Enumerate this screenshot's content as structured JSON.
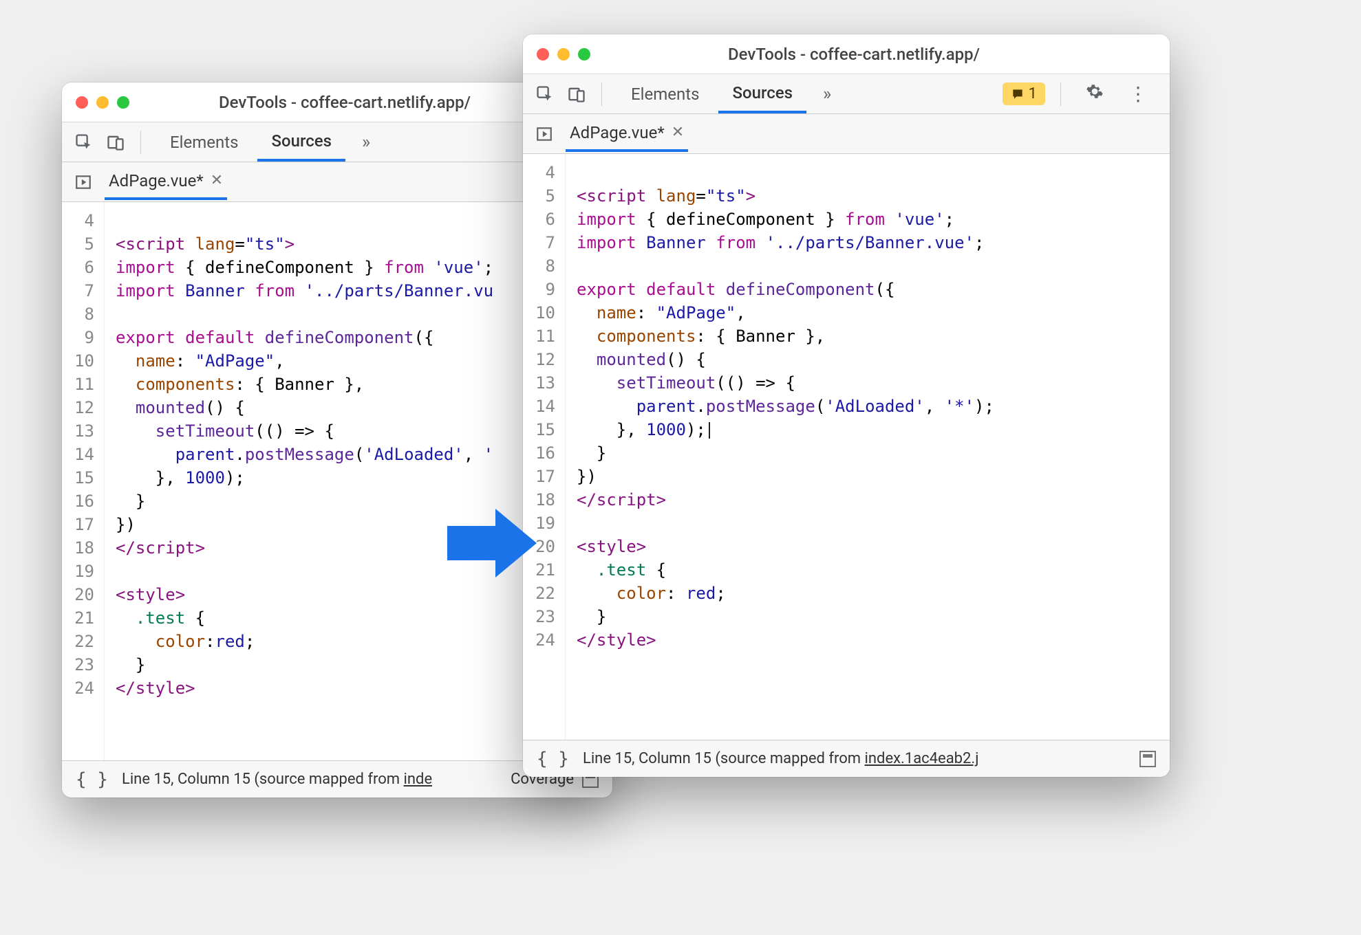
{
  "winA": {
    "title": "DevTools - coffee-cart.netlify.app/",
    "tabs": {
      "elements": "Elements",
      "sources": "Sources",
      "more": "»"
    },
    "file_tab": "AdPage.vue*",
    "line_start": 4,
    "status": {
      "pos": "Line 15, Column 15",
      "src_label": "(source mapped from ",
      "src_link": "inde",
      "coverage": "Coverage"
    }
  },
  "winB": {
    "title": "DevTools - coffee-cart.netlify.app/",
    "tabs": {
      "elements": "Elements",
      "sources": "Sources",
      "more": "»"
    },
    "warn_count": "1",
    "file_tab": "AdPage.vue*",
    "line_start": 4,
    "status": {
      "pos": "Line 15, Column 15",
      "src_label": "(source mapped from ",
      "src_link": "index.1ac4eab2.j"
    }
  },
  "code": {
    "l5_a": "<",
    "l5_tag": "script",
    "l5_sp": " ",
    "l5_attr": "lang",
    "l5_eq": "=",
    "l5_val": "\"ts\"",
    "l5_b": ">",
    "l6_kw": "import",
    "l6_mid": " { defineComponent } ",
    "l6_from": "from",
    "l6_sp": " ",
    "l6_str": "'vue'",
    "l6_semi": ";",
    "l7_kw": "import",
    "l7_sp1": " ",
    "l7_id": "Banner",
    "l7_sp2": " ",
    "l7_from": "from",
    "l7_sp3": " ",
    "l7_strA": "'../parts/Banner.vu",
    "l7_strB": "'../parts/Banner.vue'",
    "l7_semi": ";",
    "l9_kw1": "export",
    "l9_sp1": " ",
    "l9_kw2": "default",
    "l9_sp2": " ",
    "l9_fn": "defineComponent",
    "l9_paren": "({",
    "l10_ind": "  ",
    "l10_prop": "name",
    "l10_mid": ": ",
    "l10_val": "\"AdPage\"",
    "l10_comma": ",",
    "l11_ind": "  ",
    "l11_prop": "components",
    "l11_rest": ": { Banner },",
    "l12_ind": "  ",
    "l12_fn": "mounted",
    "l12_rest": "() {",
    "l13_ind": "    ",
    "l13_fn": "setTimeout",
    "l13_rest": "(() => {",
    "l14_ind": "      ",
    "l14_obj": "parent",
    "l14_dot": ".",
    "l14_fn": "postMessage",
    "l14_open": "(",
    "l14_arg1": "'AdLoaded'",
    "l14_comma": ", ",
    "l14_arg2A": "'",
    "l14_arg2B": "'*'",
    "l14_close": ");",
    "l15_indA": "    }, ",
    "l15_indB": "    }, ",
    "l15_num": "1000",
    "l15_close": ");",
    "l16": "  }",
    "l17": "})",
    "l18_a": "</",
    "l18_tag": "script",
    "l18_b": ">",
    "l20_a": "<",
    "l20_tag": "style",
    "l20_b": ">",
    "l21_ind": "  ",
    "l21_sel": ".test",
    "l21_brace": " {",
    "l22A_ind": "    ",
    "l22A_prop": "color",
    "l22A_colon": ":",
    "l22A_val": "red",
    "l22A_semi": ";",
    "l22B_ind": "    ",
    "l22B_prop": "color",
    "l22B_colon": ": ",
    "l22B_val": "red",
    "l22B_semi": ";",
    "l23": "  }",
    "l24_a": "</",
    "l24_tag": "style",
    "l24_b": ">"
  }
}
